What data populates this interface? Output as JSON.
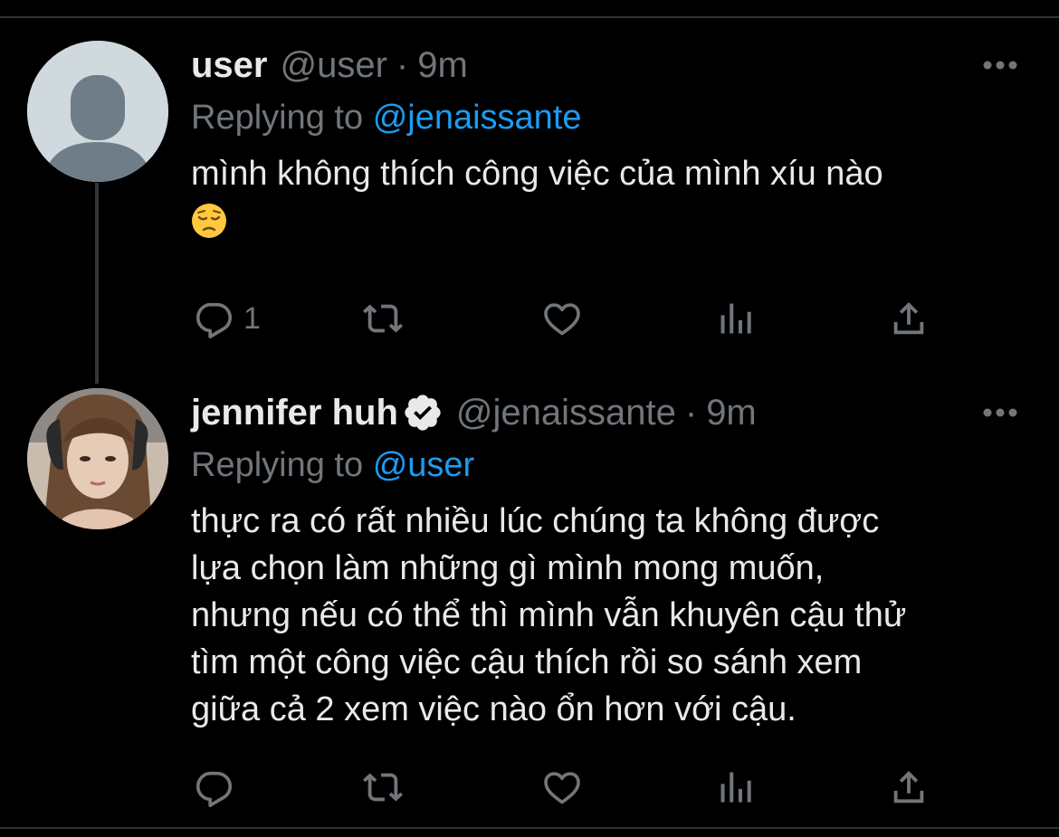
{
  "colors": {
    "background": "#000000",
    "text_primary": "#e7e9ea",
    "text_secondary": "#71767b",
    "accent": "#1d9bf0",
    "divider": "#2f3336"
  },
  "tweets": [
    {
      "display_name": "user",
      "handle": "@user",
      "separator": "·",
      "time": "9m",
      "replying_prefix": "Replying to",
      "replying_to": "@jenaissante",
      "text": "mình không thích công việc của mình xíu nào",
      "emoji": "😔",
      "avatar": "default-avatar",
      "verified": false,
      "reply_count": "1",
      "icons": [
        "reply-icon",
        "retweet-icon",
        "like-icon",
        "views-icon",
        "share-icon",
        "more-icon"
      ]
    },
    {
      "display_name": "jennifer huh",
      "handle": "@jenaissante",
      "separator": "·",
      "time": "9m",
      "replying_prefix": "Replying to",
      "replying_to": "@user",
      "text": "thực ra có rất nhiều lúc chúng ta không được\nlựa chọn làm những gì mình mong muốn,\nnhưng nếu có thể thì mình vẫn khuyên cậu thử\ntìm một công việc cậu thích rồi so sánh xem\ngiữa cả 2 xem việc nào ổn hơn với cậu.",
      "avatar": "profile-photo",
      "verified": true,
      "reply_count": "",
      "icons": [
        "reply-icon",
        "retweet-icon",
        "like-icon",
        "views-icon",
        "share-icon",
        "more-icon"
      ]
    }
  ]
}
